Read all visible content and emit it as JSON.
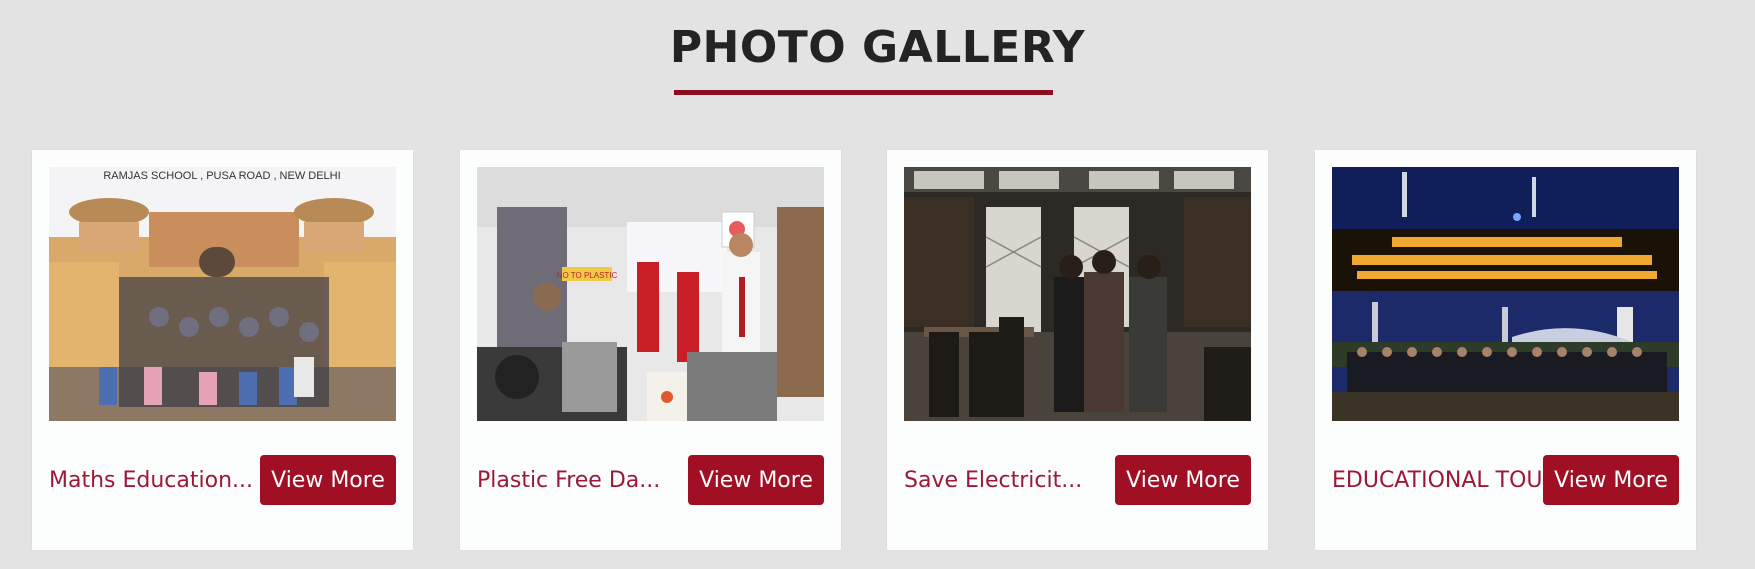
{
  "gallery": {
    "title": "PHOTO GALLERY",
    "cards": [
      {
        "caption": "Maths Education...",
        "button": "View More",
        "photo_text": "RAMJAS SCHOOL , PUSA ROAD , NEW DELHI"
      },
      {
        "caption": "Plastic Free Da...",
        "button": "View More",
        "photo_text": "NO TO PLASTIC"
      },
      {
        "caption": "Save Electricit...",
        "button": "View More"
      },
      {
        "caption": "EDUCATIONAL TOUR",
        "button": "View More"
      }
    ]
  },
  "colors": {
    "background": "#e3e3e3",
    "accent": "#a10f25",
    "caption": "#9d1838",
    "underline": "#8b0f1f"
  }
}
